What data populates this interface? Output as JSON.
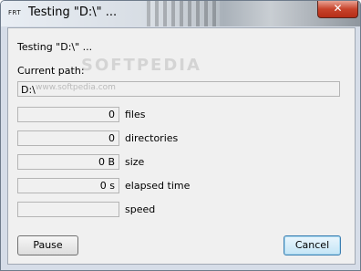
{
  "window": {
    "app_icon_text": "FRT",
    "title": "Testing \"D:\\\" ...",
    "close_glyph": "✕"
  },
  "dialog": {
    "testing_text": "Testing \"D:\\\" ...",
    "current_path_label": "Current path:",
    "current_path_value": "D:\\",
    "watermark_small": "www.softpedia.com",
    "watermark_large": "SOFTPEDIA",
    "stats": [
      {
        "value": "0",
        "label": "files"
      },
      {
        "value": "0",
        "label": "directories"
      },
      {
        "value": "0 B",
        "label": "size"
      },
      {
        "value": "0 s",
        "label": "elapsed time"
      },
      {
        "value": "",
        "label": "speed"
      }
    ],
    "pause_label": "Pause",
    "cancel_label": "Cancel"
  }
}
